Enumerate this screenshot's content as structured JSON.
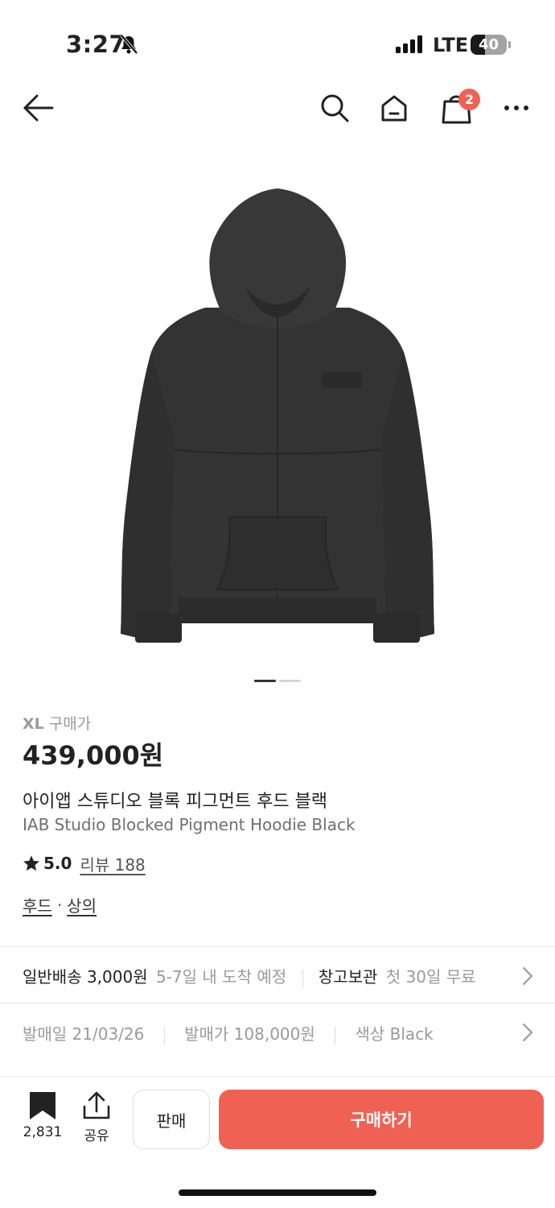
{
  "status_bar": {
    "time": "3:27",
    "network": "LTE",
    "battery": "40",
    "battery_level": 0.4
  },
  "nav": {
    "cart_badge": "2"
  },
  "carousel": {
    "current": 1,
    "total": 2
  },
  "product": {
    "size": "XL",
    "price_label": "구매가",
    "price": "439,000원",
    "name_ko": "아이앱 스튜디오 블록 피그먼트 후드 블랙",
    "name_en": "IAB Studio Blocked Pigment Hoodie Black",
    "rating": "5.0",
    "review_label": "리뷰 188",
    "category_1": "후드",
    "category_sep": "·",
    "category_2": "상의"
  },
  "delivery": {
    "shipping_label": "일반배송 3,000원",
    "shipping_eta": "5-7일 내 도착 예정",
    "storage_label": "창고보관",
    "storage_note": "첫 30일 무료"
  },
  "details": {
    "release_date": "발매일 21/03/26",
    "release_price": "발매가 108,000원",
    "color": "색상 Black"
  },
  "bottom_bar": {
    "bookmark_count": "2,831",
    "share_label": "공유",
    "sell_label": "판매",
    "buy_label": "구매하기"
  },
  "colors": {
    "accent": "#ef6253",
    "text": "#222222",
    "muted": "#9a9a9a"
  }
}
